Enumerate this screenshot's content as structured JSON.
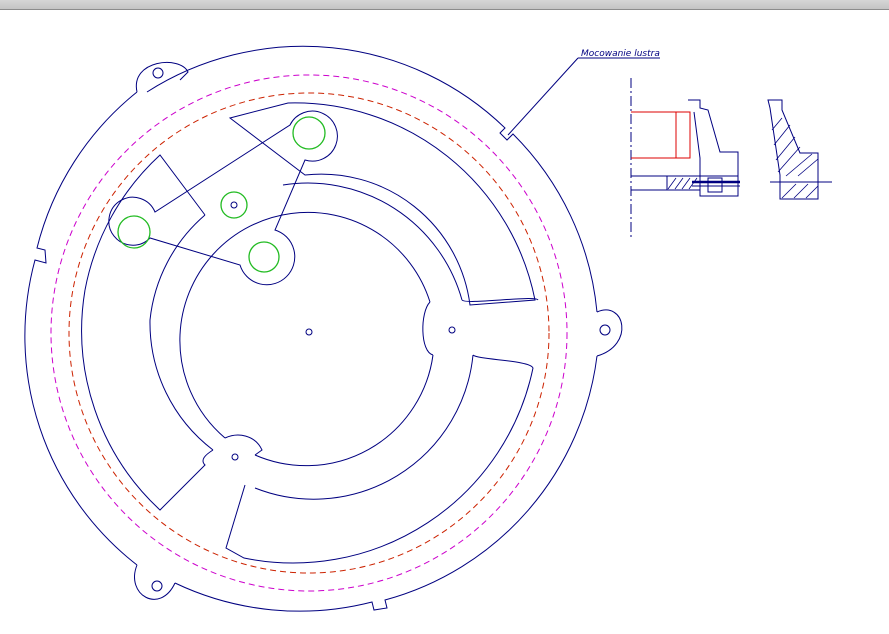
{
  "drawing": {
    "annotation_label": "Mocowanie lustra"
  },
  "colors": {
    "outline": "#000080",
    "dashed_magenta": "#cc00cc",
    "dashed_red": "#cc2200",
    "holes_green": "#22bb22",
    "section_red": "#dd0000",
    "background": "#ffffff",
    "title_bar": "#cccccc"
  },
  "icons": {
    "crosshair": "crosshair-icon"
  }
}
